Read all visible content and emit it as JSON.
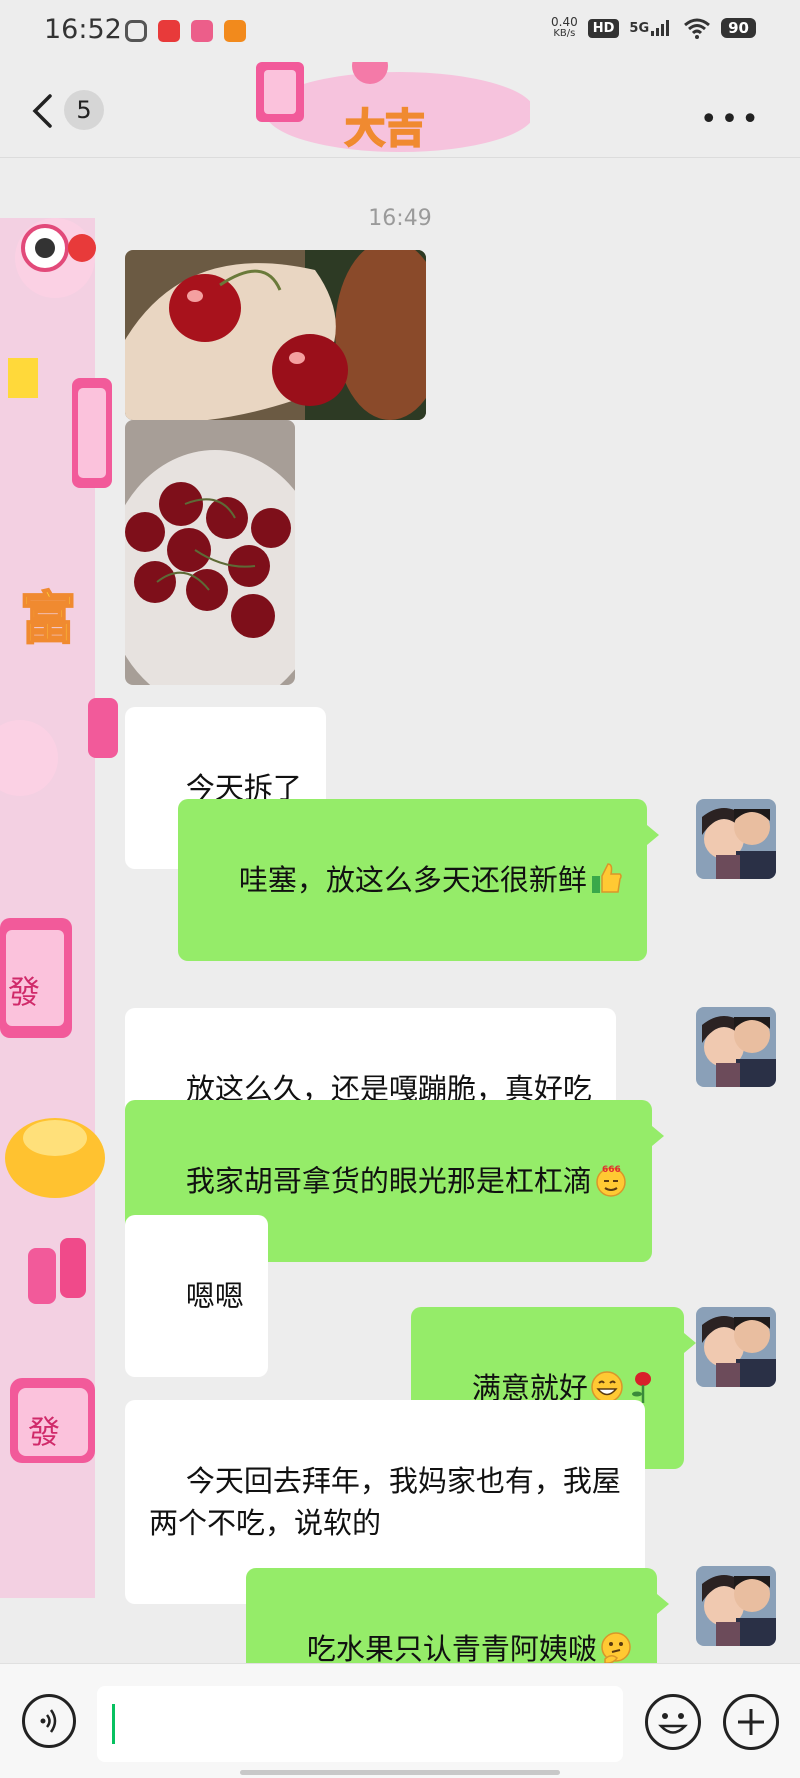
{
  "status_bar": {
    "time": "16:52",
    "net_speed_value": "0.40",
    "net_speed_unit": "KB/s",
    "hd": "HD",
    "network": "5G",
    "battery": "90"
  },
  "header": {
    "unread_count": "5"
  },
  "chat": {
    "timestamp": "16:49",
    "messages": [
      {
        "side": "in",
        "text": "今天拆了"
      },
      {
        "side": "out",
        "text": "哇塞，放这么多天还很新鲜",
        "emoji": "thumbs-up"
      },
      {
        "side": "in",
        "text": "放这么久，还是嘎蹦脆，真好吃"
      },
      {
        "side": "out",
        "text": "我家胡哥拿货的眼光那是杠杠滴",
        "emoji": "666-face"
      },
      {
        "side": "in",
        "text": "嗯嗯"
      },
      {
        "side": "out",
        "text": "满意就好",
        "emoji": "grin-rose"
      },
      {
        "side": "in",
        "text": "今天回去拜年，我妈家也有，我屋\n两个不吃，说软的"
      },
      {
        "side": "out",
        "text": "吃水果只认青青阿姨啵",
        "emoji": "thinking-face"
      }
    ]
  },
  "colors": {
    "background": "#ededed",
    "outgoing_bubble": "#95ec69",
    "incoming_bubble": "#ffffff",
    "caret": "#07c160"
  }
}
